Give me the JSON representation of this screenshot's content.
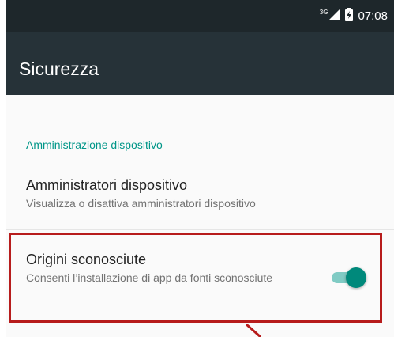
{
  "status_bar": {
    "network": "3G",
    "time": "07:08",
    "icons": [
      "signal-icon",
      "battery-icon"
    ]
  },
  "app_bar": {
    "title": "Sicurezza"
  },
  "category": {
    "label": "Amministrazione dispositivo"
  },
  "preferences": [
    {
      "title": "Amministratori dispositivo",
      "summary": "Visualizza o disattiva amministratori dispositivo"
    },
    {
      "title": "Origini sconosciute",
      "summary": "Consenti l’installazione di app da fonti sconosciute",
      "toggle_on": true
    }
  ],
  "colors": {
    "status_bar": "#1e272b",
    "app_bar": "#263238",
    "accent": "#009688",
    "toggle_thumb": "#00897b",
    "toggle_track": "#80cbc4",
    "highlight_border": "#b71c1c"
  }
}
